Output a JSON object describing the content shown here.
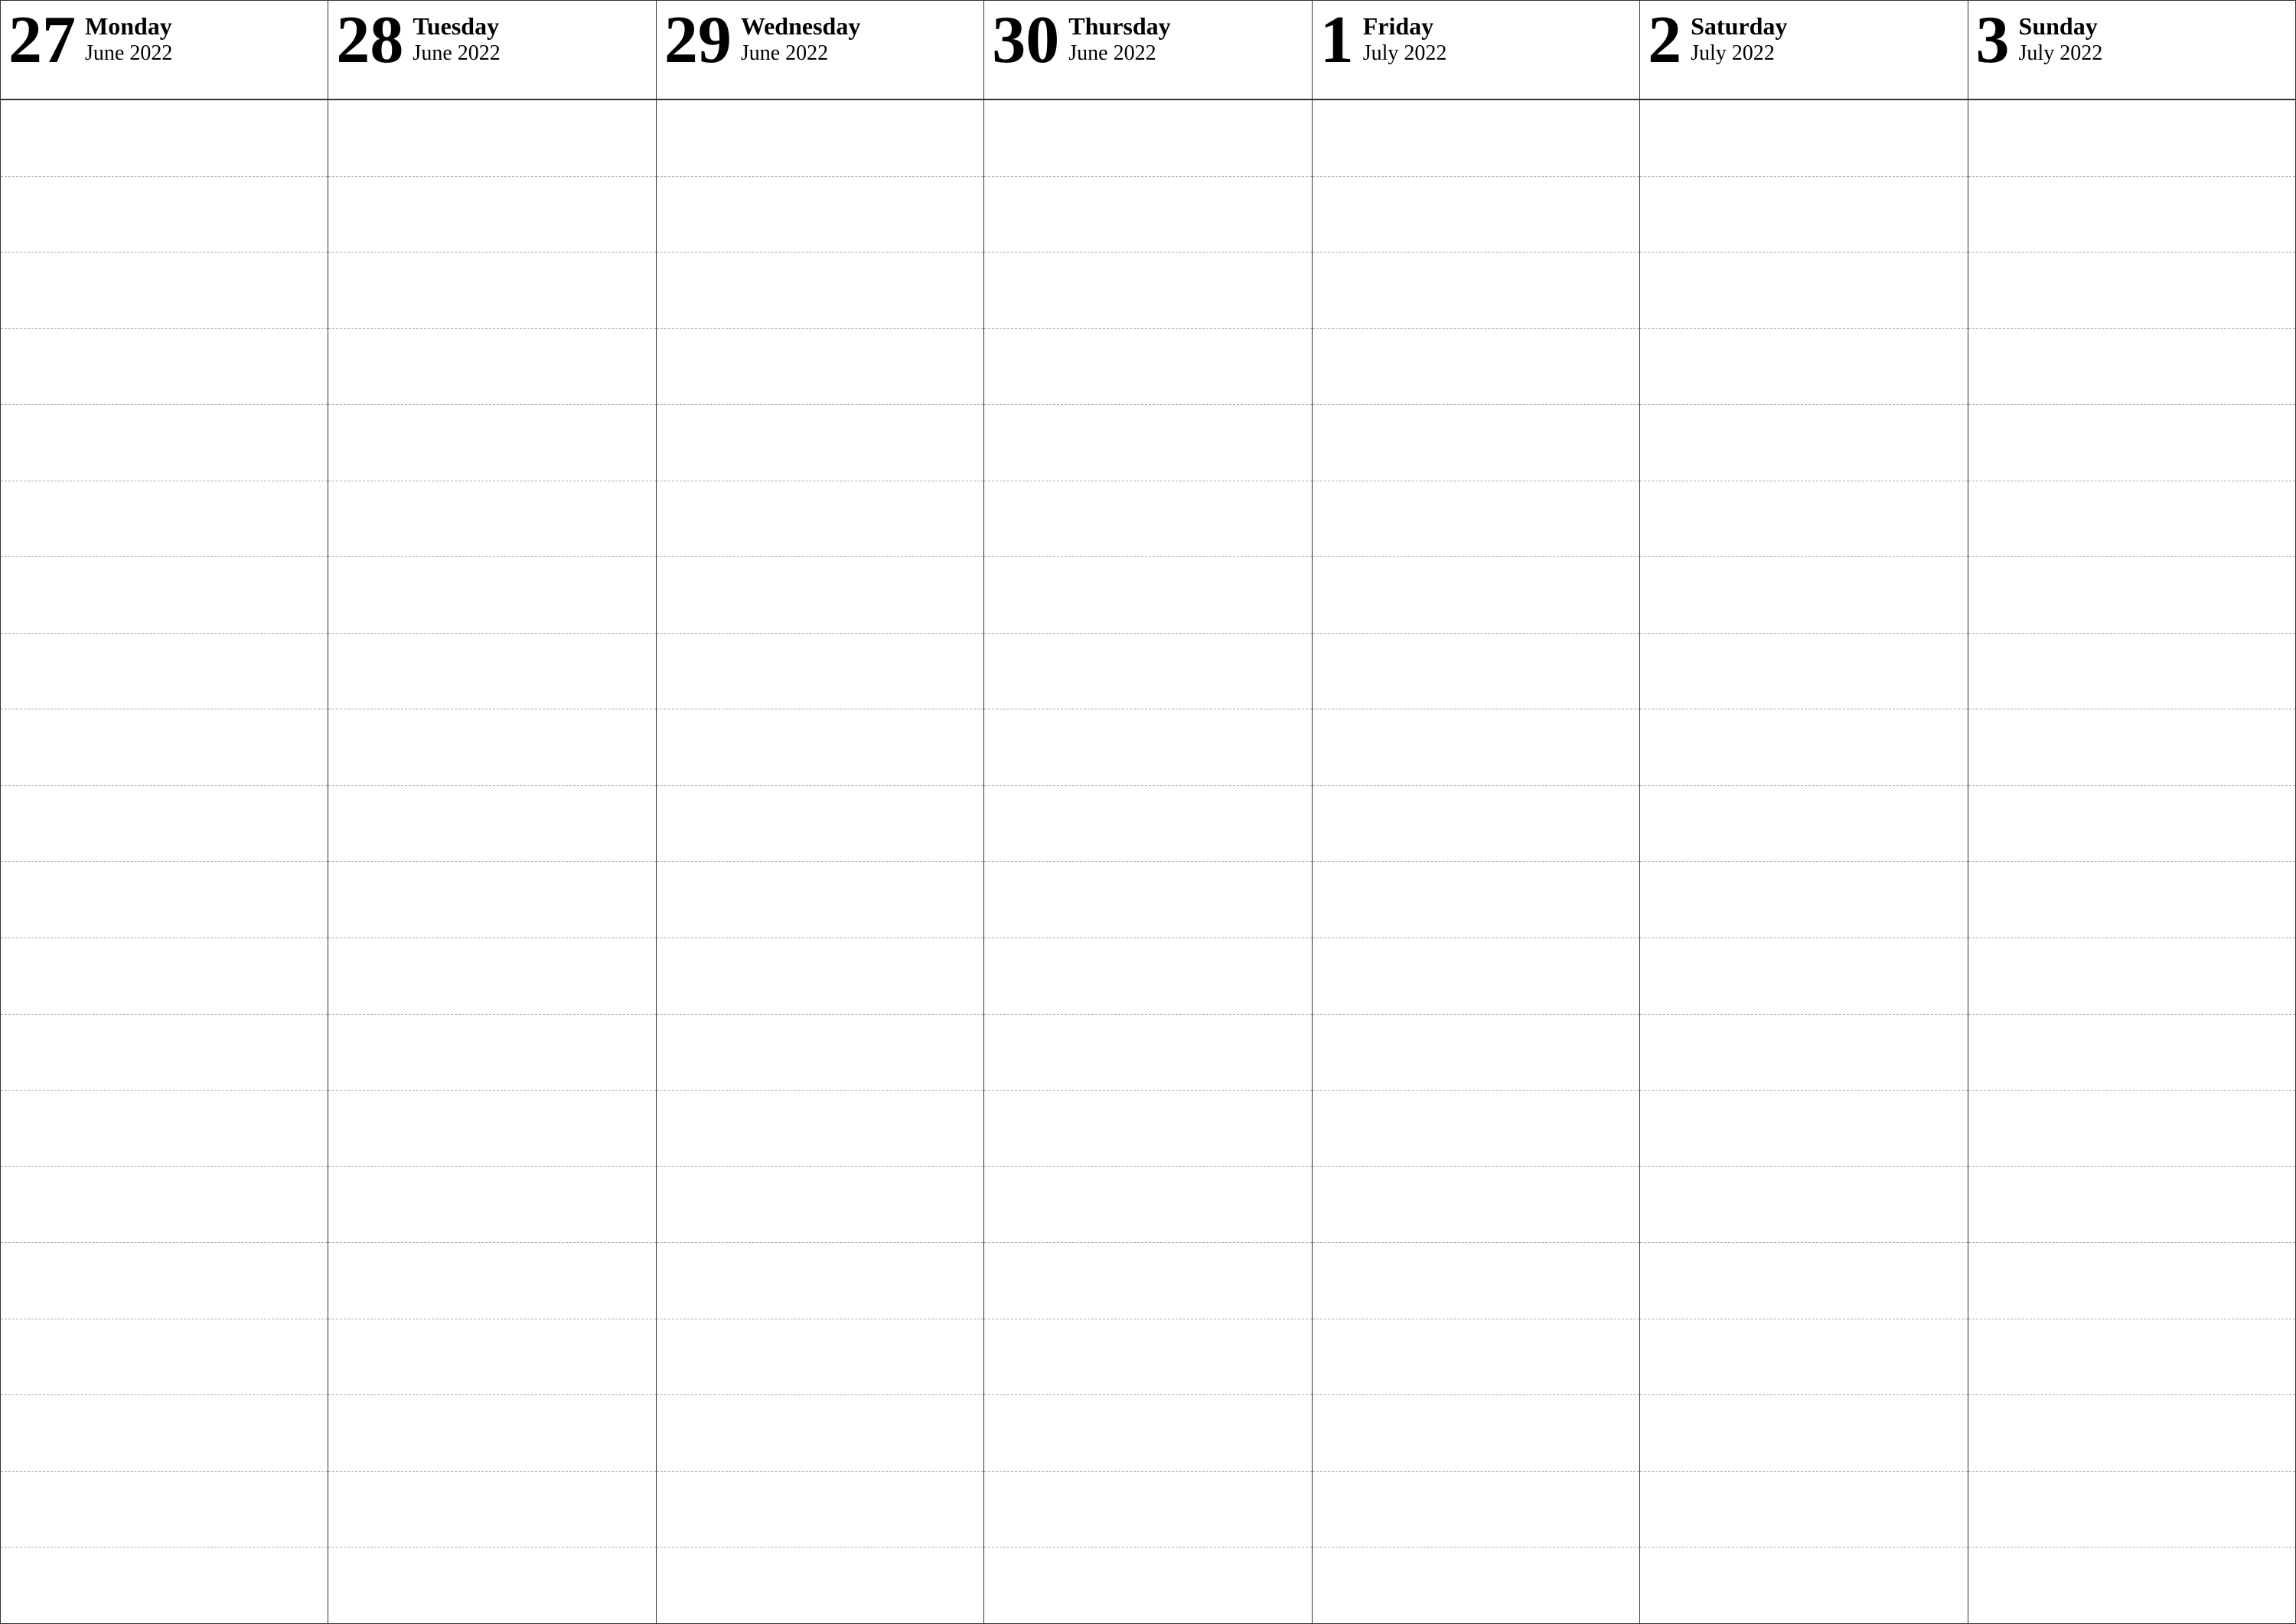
{
  "calendar": {
    "days": [
      {
        "number": "27",
        "name": "Monday",
        "month": "June 2022"
      },
      {
        "number": "28",
        "name": "Tuesday",
        "month": "June 2022"
      },
      {
        "number": "29",
        "name": "Wednesday",
        "month": "June 2022"
      },
      {
        "number": "30",
        "name": "Thursday",
        "month": "June 2022"
      },
      {
        "number": "1",
        "name": "Friday",
        "month": "July 2022"
      },
      {
        "number": "2",
        "name": "Saturday",
        "month": "July 2022"
      },
      {
        "number": "3",
        "name": "Sunday",
        "month": "July 2022"
      }
    ],
    "lines_per_day": 20
  }
}
